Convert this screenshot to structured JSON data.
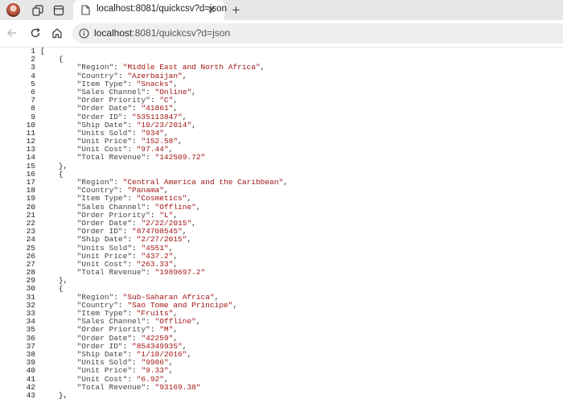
{
  "tab": {
    "title": "localhost:8081/quickcsv?d=json",
    "close_glyph": "✕"
  },
  "new_tab_glyph": "+",
  "address_bar": {
    "host": "localhost",
    "rest": ":8081/quickcsv?d=json"
  },
  "json_lines": [
    {
      "n": "1",
      "indent": "",
      "text": "["
    },
    {
      "n": "2",
      "indent": "    ",
      "text": "{"
    },
    {
      "n": "3",
      "indent": "        ",
      "key": "\"Region\"",
      "value": "\"Middle East and North Africa\"",
      "comma": ","
    },
    {
      "n": "4",
      "indent": "        ",
      "key": "\"Country\"",
      "value": "\"Azerbaijan\"",
      "comma": ","
    },
    {
      "n": "5",
      "indent": "        ",
      "key": "\"Item Type\"",
      "value": "\"Snacks\"",
      "comma": ","
    },
    {
      "n": "6",
      "indent": "        ",
      "key": "\"Sales Channel\"",
      "value": "\"Online\"",
      "comma": ","
    },
    {
      "n": "7",
      "indent": "        ",
      "key": "\"Order Priority\"",
      "value": "\"C\"",
      "comma": ","
    },
    {
      "n": "8",
      "indent": "        ",
      "key": "\"Order Date\"",
      "value": "\"41861\"",
      "comma": ","
    },
    {
      "n": "9",
      "indent": "        ",
      "key": "\"Order ID\"",
      "value": "\"535113847\"",
      "comma": ","
    },
    {
      "n": "10",
      "indent": "        ",
      "key": "\"Ship Date\"",
      "value": "\"10/23/2014\"",
      "comma": ","
    },
    {
      "n": "11",
      "indent": "        ",
      "key": "\"Units Sold\"",
      "value": "\"934\"",
      "comma": ","
    },
    {
      "n": "12",
      "indent": "        ",
      "key": "\"Unit Price\"",
      "value": "\"152.58\"",
      "comma": ","
    },
    {
      "n": "13",
      "indent": "        ",
      "key": "\"Unit Cost\"",
      "value": "\"97.44\"",
      "comma": ","
    },
    {
      "n": "14",
      "indent": "        ",
      "key": "\"Total Revenue\"",
      "value": "\"142509.72\"",
      "comma": ""
    },
    {
      "n": "15",
      "indent": "    ",
      "text": "},"
    },
    {
      "n": "16",
      "indent": "    ",
      "text": "{"
    },
    {
      "n": "17",
      "indent": "        ",
      "key": "\"Region\"",
      "value": "\"Central America and the Caribbean\"",
      "comma": ","
    },
    {
      "n": "18",
      "indent": "        ",
      "key": "\"Country\"",
      "value": "\"Panama\"",
      "comma": ","
    },
    {
      "n": "19",
      "indent": "        ",
      "key": "\"Item Type\"",
      "value": "\"Cosmetics\"",
      "comma": ","
    },
    {
      "n": "20",
      "indent": "        ",
      "key": "\"Sales Channel\"",
      "value": "\"Offline\"",
      "comma": ","
    },
    {
      "n": "21",
      "indent": "        ",
      "key": "\"Order Priority\"",
      "value": "\"L\"",
      "comma": ","
    },
    {
      "n": "22",
      "indent": "        ",
      "key": "\"Order Date\"",
      "value": "\"2/22/2015\"",
      "comma": ","
    },
    {
      "n": "23",
      "indent": "        ",
      "key": "\"Order ID\"",
      "value": "\"874708545\"",
      "comma": ","
    },
    {
      "n": "24",
      "indent": "        ",
      "key": "\"Ship Date\"",
      "value": "\"2/27/2015\"",
      "comma": ","
    },
    {
      "n": "25",
      "indent": "        ",
      "key": "\"Units Sold\"",
      "value": "\"4551\"",
      "comma": ","
    },
    {
      "n": "26",
      "indent": "        ",
      "key": "\"Unit Price\"",
      "value": "\"437.2\"",
      "comma": ","
    },
    {
      "n": "27",
      "indent": "        ",
      "key": "\"Unit Cost\"",
      "value": "\"263.33\"",
      "comma": ","
    },
    {
      "n": "28",
      "indent": "        ",
      "key": "\"Total Revenue\"",
      "value": "\"1989697.2\"",
      "comma": ""
    },
    {
      "n": "29",
      "indent": "    ",
      "text": "},"
    },
    {
      "n": "30",
      "indent": "    ",
      "text": "{"
    },
    {
      "n": "31",
      "indent": "        ",
      "key": "\"Region\"",
      "value": "\"Sub-Saharan Africa\"",
      "comma": ","
    },
    {
      "n": "32",
      "indent": "        ",
      "key": "\"Country\"",
      "value": "\"Sao Tome and Principe\"",
      "comma": ","
    },
    {
      "n": "33",
      "indent": "        ",
      "key": "\"Item Type\"",
      "value": "\"Fruits\"",
      "comma": ","
    },
    {
      "n": "34",
      "indent": "        ",
      "key": "\"Sales Channel\"",
      "value": "\"Offline\"",
      "comma": ","
    },
    {
      "n": "35",
      "indent": "        ",
      "key": "\"Order Priority\"",
      "value": "\"M\"",
      "comma": ","
    },
    {
      "n": "36",
      "indent": "        ",
      "key": "\"Order Date\"",
      "value": "\"42259\"",
      "comma": ","
    },
    {
      "n": "37",
      "indent": "        ",
      "key": "\"Order ID\"",
      "value": "\"854349935\"",
      "comma": ","
    },
    {
      "n": "38",
      "indent": "        ",
      "key": "\"Ship Date\"",
      "value": "\"1/18/2016\"",
      "comma": ","
    },
    {
      "n": "39",
      "indent": "        ",
      "key": "\"Units Sold\"",
      "value": "\"9986\"",
      "comma": ","
    },
    {
      "n": "40",
      "indent": "        ",
      "key": "\"Unit Price\"",
      "value": "\"9.33\"",
      "comma": ","
    },
    {
      "n": "41",
      "indent": "        ",
      "key": "\"Unit Cost\"",
      "value": "\"6.92\"",
      "comma": ","
    },
    {
      "n": "42",
      "indent": "        ",
      "key": "\"Total Revenue\"",
      "value": "\"93169.38\"",
      "comma": ""
    },
    {
      "n": "43",
      "indent": "    ",
      "text": "},"
    }
  ],
  "colors": {
    "key": "#444444",
    "string": "#a31515",
    "tabstrip": "#e7e7e7",
    "omnibox": "#efefef"
  }
}
